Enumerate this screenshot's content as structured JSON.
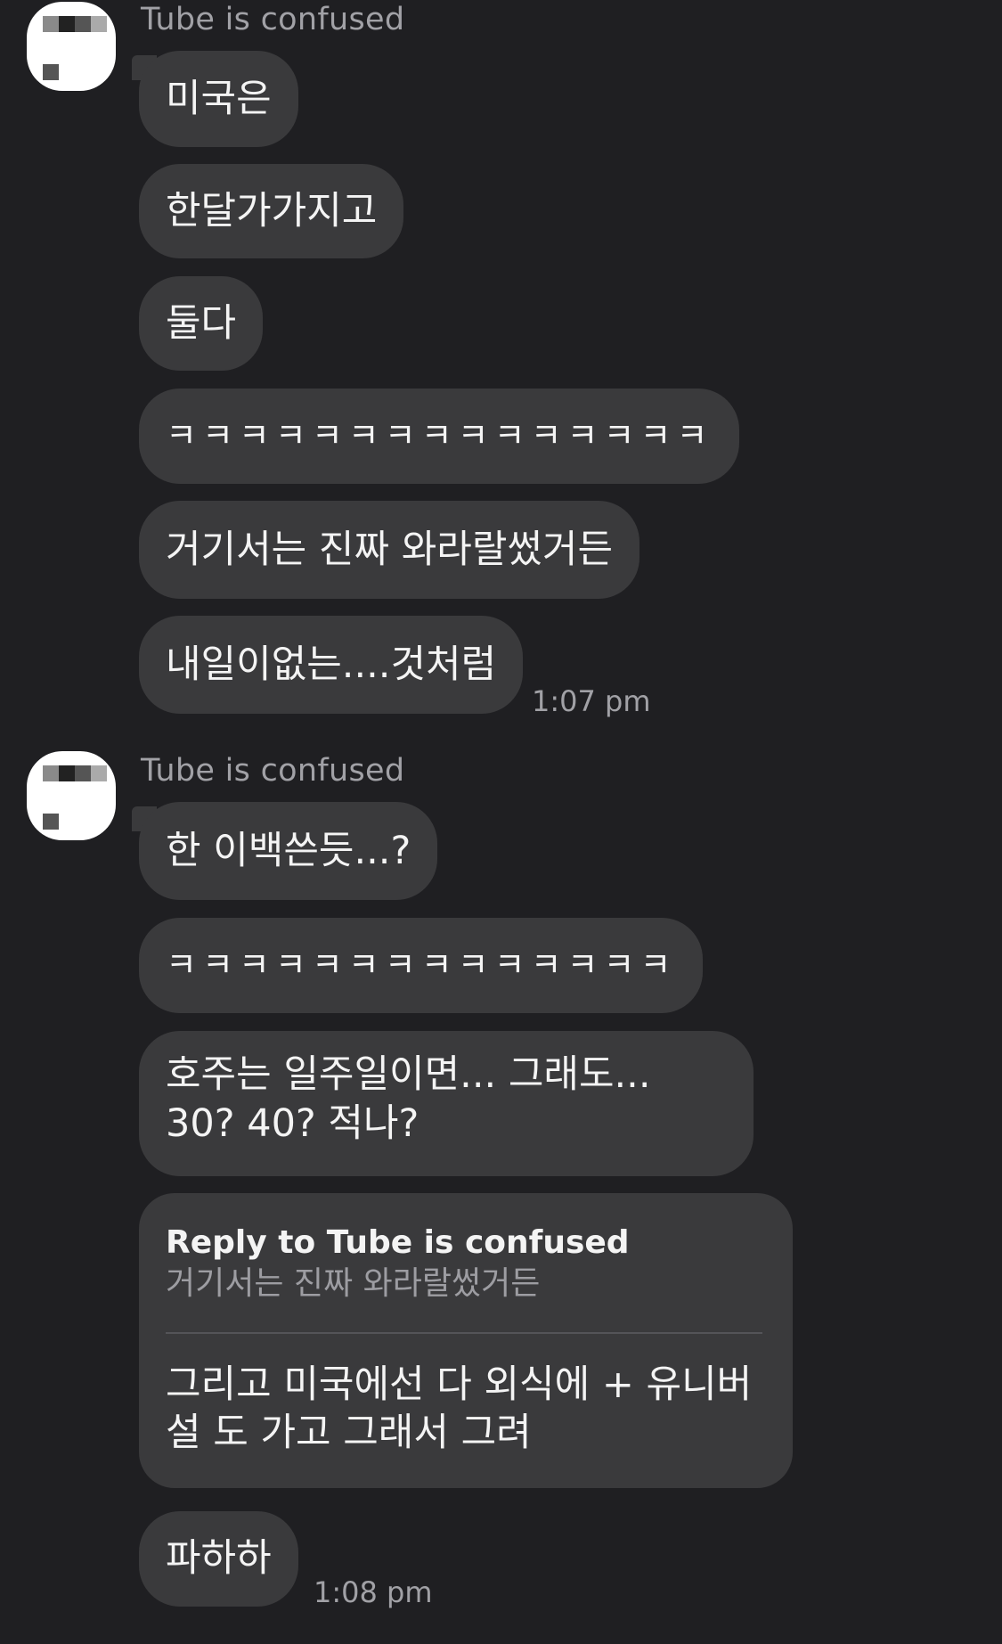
{
  "groups": [
    {
      "sender": "Tube is confused",
      "messages": [
        "미국은",
        "한달가가지고",
        "둘다",
        "ㅋㅋㅋㅋㅋㅋㅋㅋㅋㅋㅋㅋㅋㅋㅋ",
        "거기서는 진짜 와라랄썼거든",
        "내일이없는....것처럼"
      ],
      "time": "1:07 pm"
    },
    {
      "sender": "Tube is confused",
      "messages": [
        "한 이백쓴듯...?",
        "ㅋㅋㅋㅋㅋㅋㅋㅋㅋㅋㅋㅋㅋㅋ",
        "호주는 일주일이면... 그래도... 30? 40? 적나?"
      ],
      "reply": {
        "title": "Reply to Tube is confused",
        "quote": "거기서는 진짜 와라랄썼거든",
        "text": "그리고 미국에선 다 외식에 + 유니버설 도 가고 그래서 그려"
      },
      "last_message": "파하하",
      "time": "1:08 pm"
    }
  ]
}
